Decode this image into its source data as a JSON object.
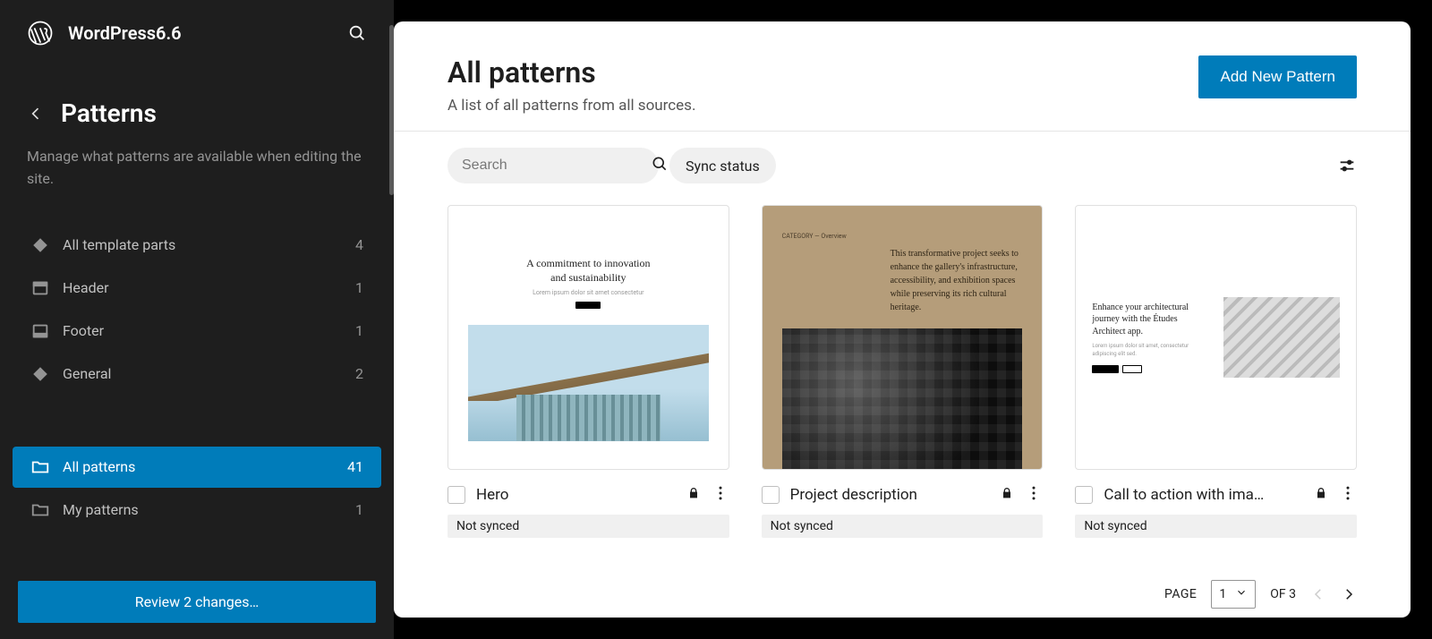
{
  "header": {
    "site_title": "WordPress6.6"
  },
  "sidebar": {
    "section_title": "Patterns",
    "section_desc": "Manage what patterns are available when editing the site.",
    "groups": {
      "template_parts": [
        {
          "label": "All template parts",
          "count": "4",
          "icon": "diamond"
        },
        {
          "label": "Header",
          "count": "1",
          "icon": "header"
        },
        {
          "label": "Footer",
          "count": "1",
          "icon": "footer"
        },
        {
          "label": "General",
          "count": "2",
          "icon": "diamond"
        }
      ],
      "patterns": [
        {
          "label": "All patterns",
          "count": "41",
          "icon": "folder",
          "active": true
        },
        {
          "label": "My patterns",
          "count": "1",
          "icon": "folder"
        }
      ]
    },
    "review_button": "Review 2 changes…"
  },
  "main": {
    "title": "All patterns",
    "subtitle": "A list of all patterns from all sources.",
    "add_button": "Add New Pattern",
    "search_placeholder": "Search",
    "filter_pill": "Sync status",
    "cards": [
      {
        "title": "Hero",
        "badge": "Not synced"
      },
      {
        "title": "Project description",
        "badge": "Not synced"
      },
      {
        "title": "Call to action with ima…",
        "badge": "Not synced"
      }
    ],
    "pagination": {
      "label": "PAGE",
      "current": "1",
      "of_label": "OF 3"
    }
  },
  "preview_text": {
    "p1_head1": "A commitment to innovation",
    "p1_head2": "and sustainability",
    "p2_text": "This transformative project seeks to enhance the gallery's infrastructure, accessibility, and exhibition spaces while preserving its rich cultural heritage.",
    "p3_head": "Enhance your architectural journey with the Études Architect app."
  }
}
